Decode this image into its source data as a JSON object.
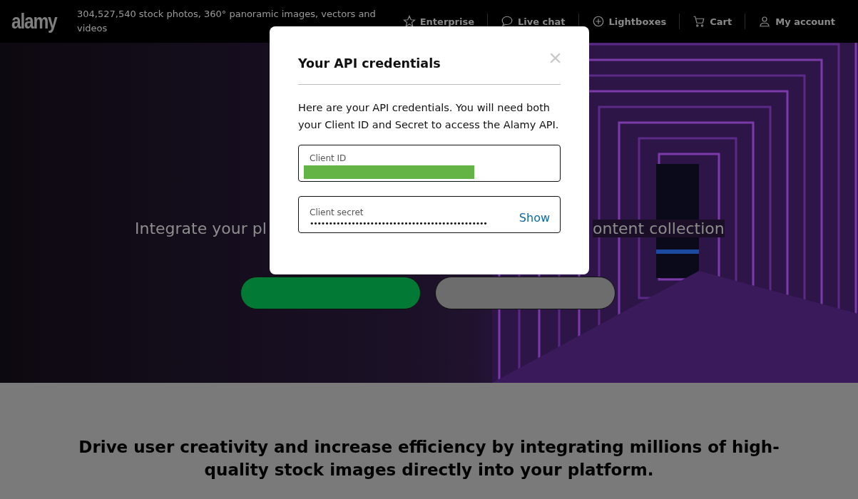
{
  "header": {
    "logo": "alamy",
    "tagline": "304,527,540 stock photos, 360° panoramic images, vectors and videos",
    "nav": [
      {
        "kind": "star",
        "label": "Enterprise"
      },
      {
        "kind": "chat",
        "label": "Live chat"
      },
      {
        "kind": "plus",
        "label": "Lightboxes"
      },
      {
        "kind": "cart",
        "label": "Cart"
      },
      {
        "kind": "user",
        "label": "My account"
      }
    ]
  },
  "hero": {
    "visible_text_left": "Integrate your pl",
    "visible_text_right": "ontent collection"
  },
  "modal": {
    "title": "Your API credentials",
    "close": "×",
    "body": "Here are your API credentials. You will need both your Client ID and Secret to access the Alamy API.",
    "fields": [
      {
        "kind": "redacted",
        "label": "Client ID"
      },
      {
        "kind": "secret",
        "label": "Client secret",
        "value": "•••••••••••••••••••••••••••••••••••••••••••••••",
        "action": "Show"
      }
    ]
  },
  "section": {
    "heading": "Drive user creativity and increase efficiency by integrating millions of high-quality stock images directly into your platform."
  }
}
